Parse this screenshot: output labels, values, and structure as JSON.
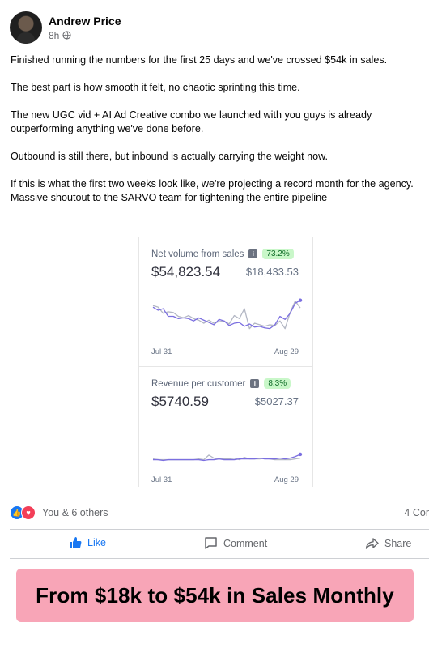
{
  "post": {
    "author": "Andrew Price",
    "time": "8h",
    "paragraphs": [
      "Finished running the numbers for the first 25 days and we've crossed $54k in sales.",
      "The best part is how smooth it felt, no chaotic sprinting this time.",
      "The new UGC vid + AI Ad Creative combo we launched with you guys is already outperforming anything we've done before.",
      "Outbound is still there, but inbound is actually carrying the weight now.",
      "If this is what the first two weeks look like, we're projecting a record month for the agency. Massive shoutout to the SARVO team for tightening the entire pipeline"
    ]
  },
  "chart_data": [
    {
      "type": "line",
      "title": "Net volume from sales",
      "badge": "73.2%",
      "value": "$54,823.54",
      "previous": "$18,433.53",
      "x_start": "Jul 31",
      "x_end": "Aug 29",
      "series": [
        {
          "color": "#7b6fe0",
          "values": [
            4.0,
            3.6,
            3.8,
            2.8,
            2.8,
            2.5,
            2.6,
            2.5,
            2.2,
            2.6,
            2.3,
            2.0,
            1.7,
            2.4,
            2.2,
            1.6,
            1.9,
            2.0,
            1.5,
            1.8,
            1.4,
            1.5,
            1.3,
            1.2,
            1.7,
            2.8,
            2.4,
            3.2,
            4.5,
            4.9
          ]
        },
        {
          "color": "#b3b7c4",
          "values": [
            4.2,
            4.0,
            3.2,
            3.4,
            3.3,
            2.8,
            2.6,
            2.9,
            2.5,
            2.3,
            1.9,
            2.3,
            1.9,
            2.1,
            2.2,
            1.8,
            2.9,
            2.5,
            3.8,
            1.2,
            1.9,
            1.7,
            1.5,
            1.7,
            1.6,
            2.2,
            1.2,
            3.3,
            4.8,
            3.9
          ]
        }
      ]
    },
    {
      "type": "line",
      "title": "Revenue per customer",
      "badge": "8.3%",
      "value": "$5740.59",
      "previous": "$5027.37",
      "x_start": "Jul 31",
      "x_end": "Aug 29",
      "series": [
        {
          "color": "#7b6fe0",
          "values": [
            1.0,
            1.0,
            0.9,
            1.0,
            1.0,
            1.0,
            1.0,
            1.0,
            1.0,
            1.0,
            0.9,
            1.0,
            1.0,
            1.1,
            1.0,
            1.0,
            1.0,
            1.1,
            1.1,
            1.1,
            1.1,
            1.2,
            1.1,
            1.1,
            1.1,
            1.2,
            1.1,
            1.2,
            1.4,
            1.7
          ]
        },
        {
          "color": "#b3b7c4",
          "values": [
            1.1,
            1.0,
            1.0,
            1.0,
            1.0,
            1.0,
            1.0,
            1.0,
            1.0,
            1.1,
            1.0,
            1.6,
            1.2,
            1.1,
            1.1,
            1.1,
            1.2,
            1.0,
            1.3,
            1.1,
            1.1,
            1.1,
            1.2,
            1.1,
            1.0,
            1.0,
            1.0,
            1.0,
            1.1,
            1.2
          ]
        }
      ]
    }
  ],
  "reactions": {
    "summary": "You & 6 others",
    "comments": "4 Cor"
  },
  "actions": {
    "like": "Like",
    "comment": "Comment",
    "share": "Share"
  },
  "banner": {
    "text": "From $18k to $54k in Sales Monthly"
  }
}
